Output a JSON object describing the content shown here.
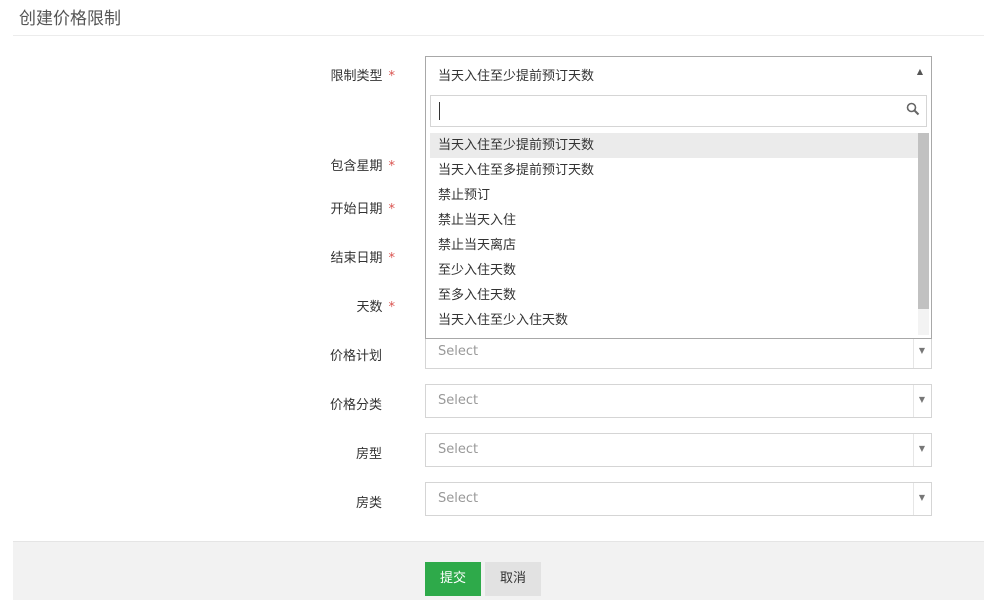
{
  "page": {
    "title": "创建价格限制"
  },
  "form": {
    "restriction_type": {
      "label": "限制类型",
      "required_mark": "*",
      "value": "当天入住至少提前预订天数"
    },
    "weekdays": {
      "label": "包含星期",
      "required_mark": "*"
    },
    "start_date": {
      "label": "开始日期",
      "required_mark": "*"
    },
    "end_date": {
      "label": "结束日期",
      "required_mark": "*"
    },
    "days": {
      "label": "天数",
      "required_mark": "*"
    },
    "rate_plan": {
      "label": "价格计划",
      "placeholder": "Select"
    },
    "rate_category": {
      "label": "价格分类",
      "placeholder": "Select"
    },
    "room_type": {
      "label": "房型",
      "placeholder": "Select"
    },
    "room_class": {
      "label": "房类",
      "placeholder": "Select"
    }
  },
  "dropdown": {
    "search_value": "",
    "options": [
      "当天入住至少提前预订天数",
      "当天入住至多提前预订天数",
      "禁止预订",
      "禁止当天入住",
      "禁止当天离店",
      "至少入住天数",
      "至多入住天数",
      "当天入住至少入住天数"
    ],
    "highlighted_index": 0
  },
  "actions": {
    "submit_label": "提交",
    "cancel_label": "取消"
  },
  "colors": {
    "required": "#d9534f",
    "submit": "#2eaa4a",
    "cancel": "#e2e2e2"
  },
  "icons": {
    "search": "search-icon",
    "arrow_up": "arrow-up-icon",
    "arrow_down": "arrow-down-icon"
  }
}
